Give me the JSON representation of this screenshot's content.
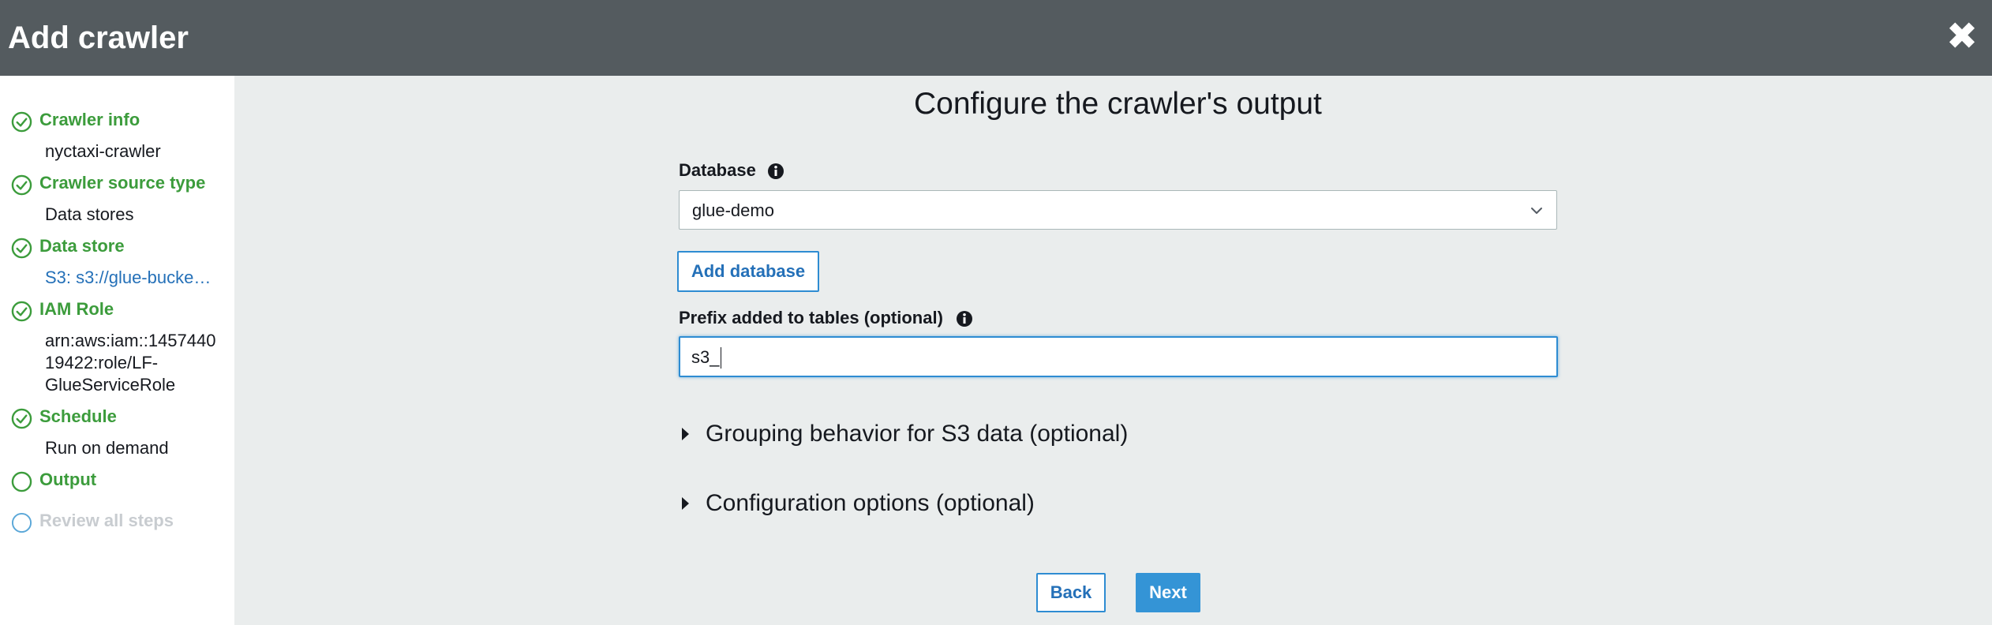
{
  "window": {
    "title": "Add crawler"
  },
  "sidebar": {
    "steps": [
      {
        "label": "Crawler info",
        "value": "nyctaxi-crawler",
        "status": "complete"
      },
      {
        "label": "Crawler source type",
        "value": "Data stores",
        "status": "complete"
      },
      {
        "label": "Data store",
        "value": "S3: s3://glue-bucke…",
        "status": "complete"
      },
      {
        "label": "IAM Role",
        "value_lines": [
          "arn:aws:iam::1457440",
          "19422:role/LF-",
          "GlueServiceRole"
        ],
        "status": "complete"
      },
      {
        "label": "Schedule",
        "value": "Run on demand",
        "status": "complete"
      },
      {
        "label": "Output",
        "status": "current"
      },
      {
        "label": "Review all steps",
        "status": "pending"
      }
    ]
  },
  "main": {
    "title": "Configure the crawler's output",
    "database": {
      "label": "Database",
      "selected": "glue-demo"
    },
    "add_database_label": "Add database",
    "prefix": {
      "label": "Prefix added to tables (optional)",
      "value": "s3_"
    },
    "sections": [
      {
        "label": "Grouping behavior for S3 data (optional)",
        "expanded": false
      },
      {
        "label": "Configuration options (optional)",
        "expanded": false
      }
    ]
  },
  "footer": {
    "back_label": "Back",
    "next_label": "Next"
  },
  "colors": {
    "header_bg": "#545b5f",
    "complete": "#3c9c3c",
    "link": "#2470b8",
    "primary": "#3494d6",
    "pending": "#c8ccd0"
  },
  "icons": {
    "complete": "check-circle-icon",
    "current": "circle-icon",
    "info": "info-icon",
    "dropdown": "chevron-down-icon",
    "expander": "caret-right-icon",
    "close": "close-icon"
  }
}
